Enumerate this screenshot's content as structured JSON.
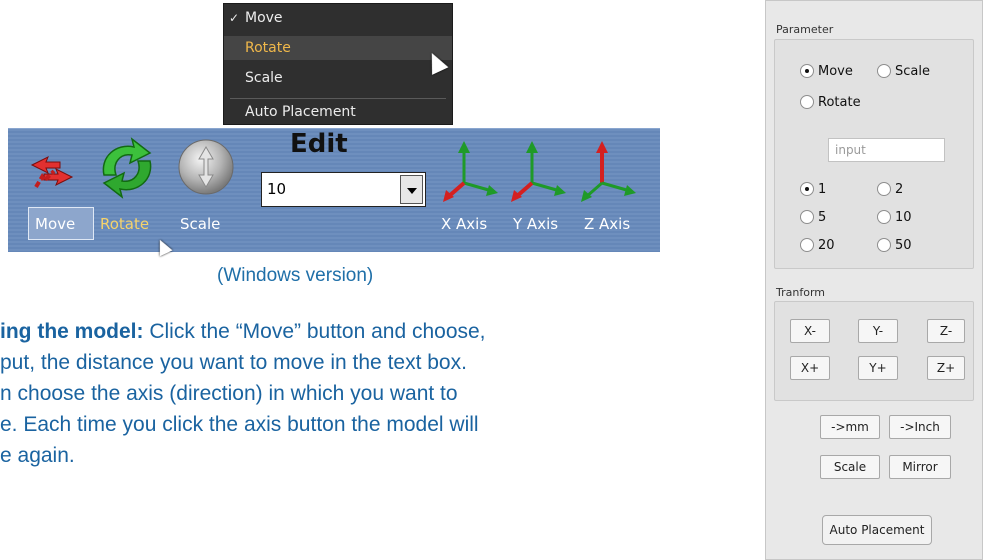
{
  "menu": {
    "items": [
      {
        "label": "Move",
        "checked": true
      },
      {
        "label": "Rotate",
        "hovered": true
      },
      {
        "label": "Scale"
      },
      {
        "label": "Auto Placement"
      }
    ],
    "check_glyph": "✓"
  },
  "toolbar": {
    "buttons": [
      {
        "label": "Move",
        "icon": "move-arrows-icon",
        "active": true
      },
      {
        "label": "Rotate",
        "icon": "rotate-arrows-icon"
      },
      {
        "label": "Scale",
        "icon": "scale-knob-icon"
      },
      {
        "label": "X Axis",
        "icon": "x-axis-icon"
      },
      {
        "label": "Y Axis",
        "icon": "y-axis-icon"
      },
      {
        "label": "Z Axis",
        "icon": "z-axis-icon"
      }
    ],
    "edit_title": "Edit",
    "edit_value": "10",
    "colors": {
      "background": "#6e8fbe",
      "active_label": "#f6d36b",
      "axis_red": "#d42020",
      "axis_green": "#21a02a"
    }
  },
  "caption": "(Windows version)",
  "body": {
    "lines": [
      {
        "bold": "ing the model:",
        "text": " Click the “Move” button and choose,"
      },
      {
        "bold": "",
        "text": "put, the distance you want to move in the text box."
      },
      {
        "bold": "",
        "text": "n choose the axis (direction) in which you want to"
      },
      {
        "bold": "",
        "text": "e. Each time you click the axis button the model will"
      },
      {
        "bold": "",
        "text": "e again."
      }
    ],
    "color": "#1a63a0"
  },
  "panel": {
    "parameter_label": "Parameter",
    "modes": [
      {
        "label": "Move",
        "selected": true
      },
      {
        "label": "Scale",
        "selected": false
      },
      {
        "label": "Rotate",
        "selected": false
      }
    ],
    "input_placeholder": "input",
    "steps": [
      {
        "label": "1",
        "selected": true
      },
      {
        "label": "2",
        "selected": false
      },
      {
        "label": "5",
        "selected": false
      },
      {
        "label": "10",
        "selected": false
      },
      {
        "label": "20",
        "selected": false
      },
      {
        "label": "50",
        "selected": false
      }
    ],
    "transform_label": "Tranform",
    "axis_buttons": [
      "X-",
      "Y-",
      "Z-",
      "X+",
      "Y+",
      "Z+"
    ],
    "unit_buttons": [
      "->mm",
      "->Inch"
    ],
    "action_buttons": [
      "Scale",
      "Mirror"
    ],
    "auto_button": "Auto Placement"
  }
}
